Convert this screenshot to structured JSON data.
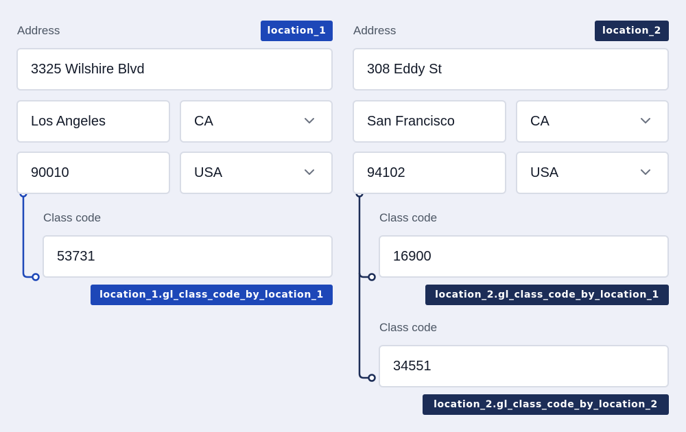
{
  "colors": {
    "background": "#eef0f8",
    "tag_blue": "#1d47b8",
    "tag_navy": "#1c2d57",
    "connector_blue": "#1d47b8",
    "connector_navy": "#1c2d57"
  },
  "location_1": {
    "address_label": "Address",
    "tag": "location_1",
    "street": "3325 Wilshire Blvd",
    "city": "Los Angeles",
    "state": "CA",
    "zip": "90010",
    "country": "USA",
    "class_codes": [
      {
        "label": "Class code",
        "value": "53731",
        "tag": "location_1.gl_class_code_by_location_1"
      }
    ]
  },
  "location_2": {
    "address_label": "Address",
    "tag": "location_2",
    "street": "308 Eddy St",
    "city": "San Francisco",
    "state": "CA",
    "zip": "94102",
    "country": "USA",
    "class_codes": [
      {
        "label": "Class code",
        "value": "16900",
        "tag": "location_2.gl_class_code_by_location_1"
      },
      {
        "label": "Class code",
        "value": "34551",
        "tag": "location_2.gl_class_code_by_location_2"
      }
    ]
  },
  "icons": {
    "dropdown": "chevron-down-icon"
  }
}
